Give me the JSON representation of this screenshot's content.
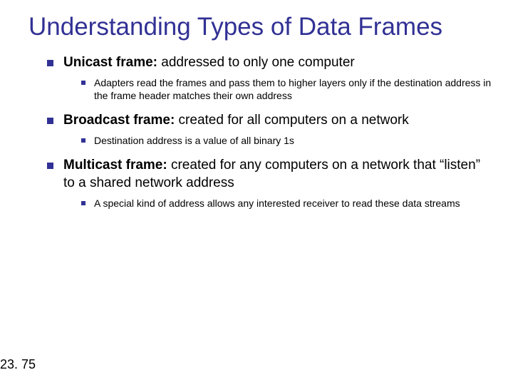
{
  "title": "Understanding Types of Data Frames",
  "items": [
    {
      "label_bold": "Unicast frame:",
      "label_rest": " addressed to only one computer",
      "sub": "Adapters read the frames and pass them to higher layers only if the destination address in the frame header matches their own address"
    },
    {
      "label_bold": "Broadcast frame:",
      "label_rest": " created for all computers on a network",
      "sub": "Destination address is a value of all binary 1s"
    },
    {
      "label_bold": "Multicast frame:",
      "label_rest": " created for any computers on a network that “listen” to a shared network address",
      "sub": "A special kind of address allows any interested receiver to read these data streams"
    }
  ],
  "page_number": "23. 75"
}
